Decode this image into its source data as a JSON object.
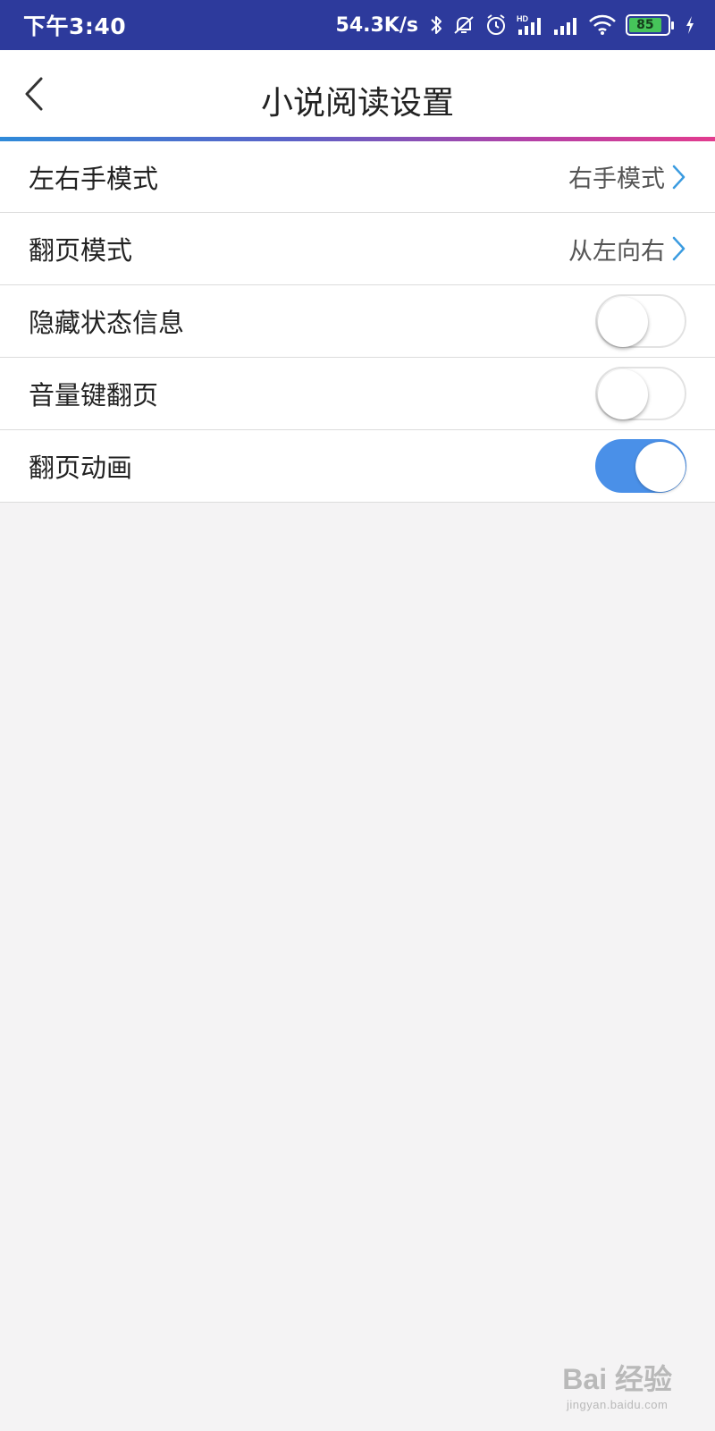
{
  "status_bar": {
    "time": "下午3:40",
    "net_speed": "54.3K/s",
    "battery_level": "85",
    "icons": [
      "bluetooth-icon",
      "mute-icon",
      "alarm-icon",
      "hd-signal-icon",
      "signal-icon",
      "wifi-icon",
      "battery-icon",
      "charging-icon"
    ]
  },
  "header": {
    "title": "小说阅读设置",
    "back_icon": "chevron-left-icon"
  },
  "settings": {
    "rows": [
      {
        "label": "左右手模式",
        "value": "右手模式",
        "type": "select"
      },
      {
        "label": "翻页模式",
        "value": "从左向右",
        "type": "select"
      },
      {
        "label": "隐藏状态信息",
        "type": "toggle",
        "enabled": false
      },
      {
        "label": "音量键翻页",
        "type": "toggle",
        "enabled": false
      },
      {
        "label": "翻页动画",
        "type": "toggle",
        "enabled": true
      }
    ]
  },
  "watermark": {
    "main": "Bai 经验",
    "sub": "jingyan.baidu.com"
  },
  "colors": {
    "status_bar": "#2d3a9c",
    "toggle_on": "#4a90e8",
    "chevron": "#3a9be0",
    "accent_start": "#2f8ad9",
    "accent_end": "#e23c8e"
  }
}
